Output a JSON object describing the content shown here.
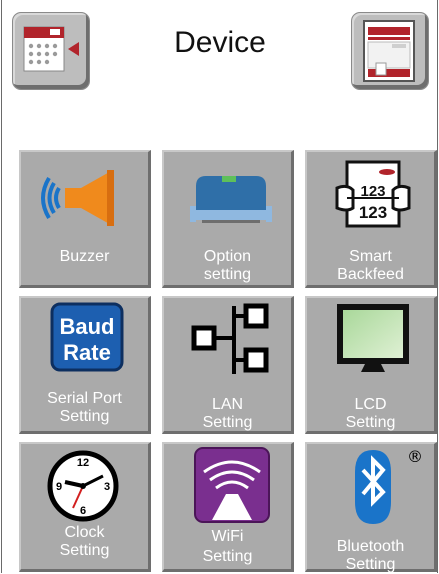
{
  "header": {
    "title": "Device",
    "left_button_icon": "calendar-back-icon",
    "right_button_icon": "printer-label-icon"
  },
  "tiles": [
    {
      "label1": "Buzzer",
      "label2": "",
      "icon": "speaker-icon"
    },
    {
      "label1": "Option",
      "label2": "setting",
      "icon": "option-module-icon"
    },
    {
      "label1": "Smart",
      "label2": "Backfeed",
      "icon": "label-backfeed-icon",
      "icon_text1": "123",
      "icon_text2": "123"
    },
    {
      "label1": "Serial Port",
      "label2": "Setting",
      "icon": "baud-rate-icon",
      "icon_text1": "Baud",
      "icon_text2": "Rate"
    },
    {
      "label1": "LAN",
      "label2": "Setting",
      "icon": "network-icon"
    },
    {
      "label1": "LCD",
      "label2": "Setting",
      "icon": "monitor-icon"
    },
    {
      "label1": "Clock",
      "label2": "Setting",
      "icon": "clock-icon",
      "icon_text1": "12",
      "icon_text2": "3",
      "icon_text3": "6",
      "icon_text4": "9"
    },
    {
      "label1": "WiFi",
      "label2": "Setting",
      "icon": "wifi-icon"
    },
    {
      "label1": "Bluetooth",
      "label2": "Setting",
      "icon": "bluetooth-icon",
      "icon_text1": "®"
    }
  ],
  "colors": {
    "tile_bg": "#aaaaaa",
    "accent_red": "#b1242b",
    "speaker_orange": "#f08a1c",
    "bluetooth_blue": "#1a74c9",
    "wifi_purple": "#7a2f8f"
  }
}
